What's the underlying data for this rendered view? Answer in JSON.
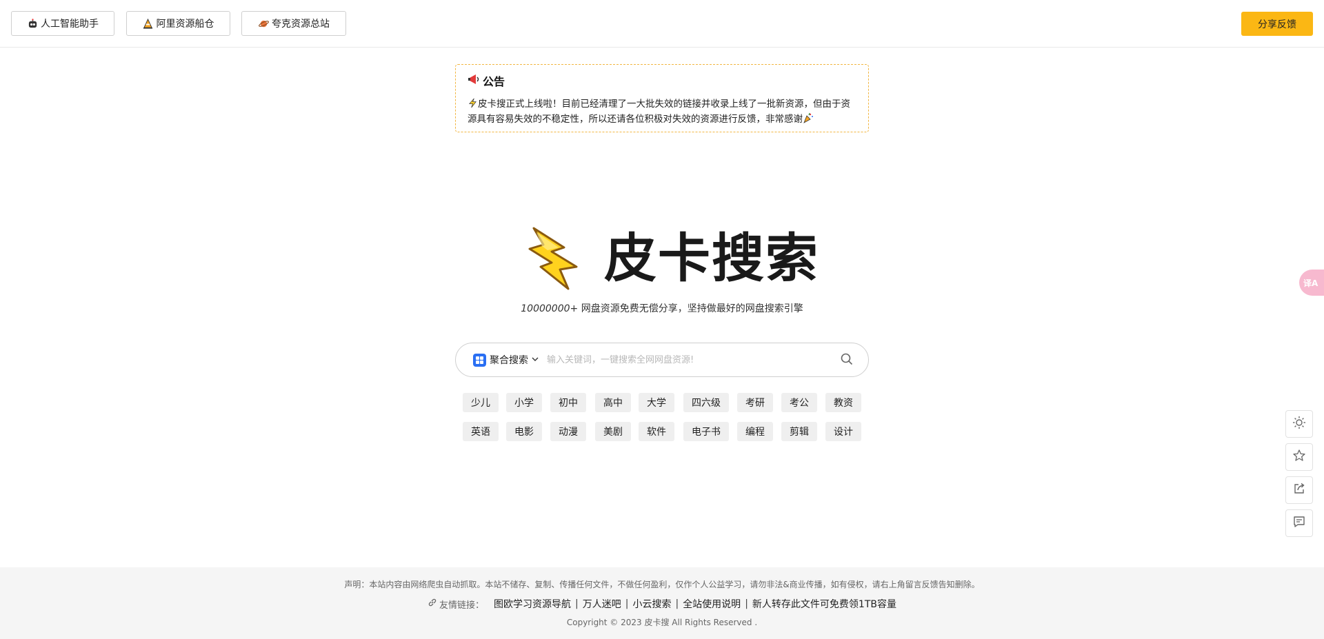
{
  "header": {
    "nav": [
      {
        "label": "人工智能助手",
        "icon": "robot-icon"
      },
      {
        "label": "阿里资源船仓",
        "icon": "warning-cone-icon"
      },
      {
        "label": "夸克资源总站",
        "icon": "planet-icon"
      }
    ],
    "share_label": "分享反馈"
  },
  "notice": {
    "icon": "megaphone-icon",
    "title": "公告",
    "body": "皮卡搜正式上线啦！目前已经清理了一大批失效的链接并收录上线了一批新资源，但由于资源具有容易失效的不稳定性，所以还请各位积极对失效的资源进行反馈，非常感谢"
  },
  "hero": {
    "logo_icon": "lightning-bolt-icon",
    "site_name": "皮卡搜索",
    "tagline_count": "10000000+",
    "tagline_text": " 网盘资源免费无偿分享，坚持做最好的网盘搜索引擎"
  },
  "search": {
    "mode_label": "聚合搜索",
    "placeholder": "输入关键词，一键搜索全网网盘资源!",
    "value": ""
  },
  "tags": {
    "row1": [
      "少儿",
      "小学",
      "初中",
      "高中",
      "大学",
      "四六级",
      "考研",
      "考公",
      "教资"
    ],
    "row2": [
      "英语",
      "电影",
      "动漫",
      "美剧",
      "软件",
      "电子书",
      "编程",
      "剪辑",
      "设计"
    ]
  },
  "tools": {
    "translate_label": "译A",
    "items": [
      "sun-icon",
      "star-icon",
      "share-icon",
      "comment-icon"
    ]
  },
  "footer": {
    "disclaimer": "声明：本站内容由网络爬虫自动抓取。本站不储存、复制、传播任何文件，不做任何盈利，仅作个人公益学习，请勿非法&商业传播，如有侵权，请右上角留言反馈告知删除。",
    "links_label": "友情链接：",
    "links": [
      "图欧学习资源导航",
      "万人迷吧",
      "小云搜索",
      "全站使用说明",
      "新人转存此文件可免费领1TB容量"
    ],
    "separator": "|",
    "copyright": "Copyright © 2023 皮卡搜 All Rights Reserved ."
  },
  "colors": {
    "accent": "#fbb714",
    "notice_border": "#f2b640",
    "mode_icon": "#2a6ff3",
    "tag_bg": "#efefef",
    "footer_bg": "#f5f5f5"
  }
}
